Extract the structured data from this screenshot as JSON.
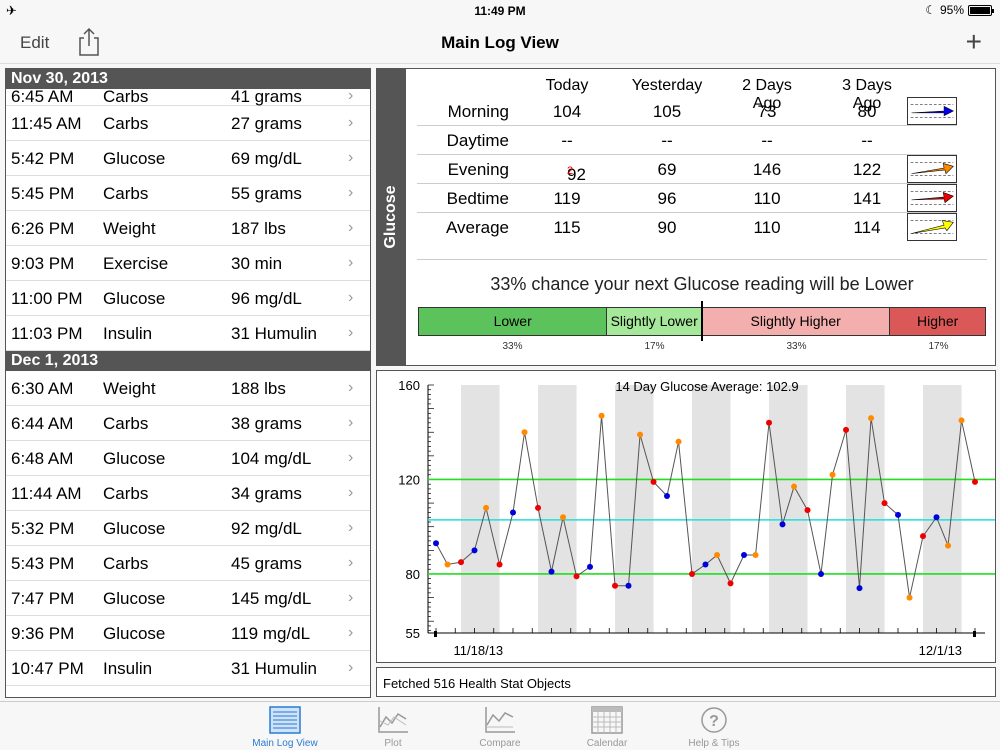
{
  "status_bar": {
    "time": "11:49 PM",
    "battery": "95%"
  },
  "nav": {
    "edit_label": "Edit",
    "title": "Main Log View",
    "add_label": "+"
  },
  "log": {
    "sections": [
      {
        "date": "Nov 30, 2013",
        "rows": [
          {
            "time": "6:45 AM",
            "type": "Carbs",
            "value": "41 grams"
          },
          {
            "time": "11:45 AM",
            "type": "Carbs",
            "value": "27 grams"
          },
          {
            "time": "5:42 PM",
            "type": "Glucose",
            "value": "69 mg/dL"
          },
          {
            "time": "5:45 PM",
            "type": "Carbs",
            "value": "55 grams"
          },
          {
            "time": "6:26 PM",
            "type": "Weight",
            "value": "187 lbs"
          },
          {
            "time": "9:03 PM",
            "type": "Exercise",
            "value": "30 min"
          },
          {
            "time": "11:00 PM",
            "type": "Glucose",
            "value": "96 mg/dL"
          },
          {
            "time": "11:03 PM",
            "type": "Insulin",
            "value": "31 Humulin"
          }
        ]
      },
      {
        "date": "Dec 1, 2013",
        "rows": [
          {
            "time": "6:30 AM",
            "type": "Weight",
            "value": "188 lbs"
          },
          {
            "time": "6:44 AM",
            "type": "Carbs",
            "value": "38 grams"
          },
          {
            "time": "6:48 AM",
            "type": "Glucose",
            "value": "104 mg/dL"
          },
          {
            "time": "11:44 AM",
            "type": "Carbs",
            "value": "34 grams"
          },
          {
            "time": "5:32 PM",
            "type": "Glucose",
            "value": "92 mg/dL"
          },
          {
            "time": "5:43 PM",
            "type": "Carbs",
            "value": "45 grams"
          },
          {
            "time": "7:47 PM",
            "type": "Glucose",
            "value": "145 mg/dL"
          },
          {
            "time": "9:36 PM",
            "type": "Glucose",
            "value": "119 mg/dL"
          },
          {
            "time": "10:47 PM",
            "type": "Insulin",
            "value": "31 Humulin"
          }
        ]
      }
    ]
  },
  "glucose_panel": {
    "tab_label": "Glucose",
    "columns": [
      "Today",
      "Yesterday",
      "2 Days Ago",
      "3 Days Ago"
    ],
    "rows": [
      {
        "label": "Morning",
        "values": [
          "104",
          "105",
          "73",
          "80"
        ],
        "trend_color": "#0000ee"
      },
      {
        "label": "Daytime",
        "values": [
          "--",
          "--",
          "--",
          "--"
        ],
        "trend_color": ""
      },
      {
        "label": "Evening",
        "values": [
          "92",
          "69",
          "146",
          "122"
        ],
        "today_superscript": "2",
        "trend_color": "#ff8a00"
      },
      {
        "label": "Bedtime",
        "values": [
          "119",
          "96",
          "110",
          "141"
        ],
        "trend_color": "#ee0000"
      },
      {
        "label": "Average",
        "values": [
          "115",
          "90",
          "110",
          "114"
        ],
        "trend_color": "#ffff00"
      }
    ],
    "prediction": "33% chance your next Glucose reading will be Lower",
    "probabilities": [
      {
        "label": "Lower",
        "percent": "33%",
        "color": "#5cc35c"
      },
      {
        "label": "Slightly Lower",
        "percent": "17%",
        "color": "#a6e89a"
      },
      {
        "label": "Slightly Higher",
        "percent": "33%",
        "color": "#f3aeae"
      },
      {
        "label": "Higher",
        "percent": "17%",
        "color": "#db5858"
      }
    ]
  },
  "chart_data": {
    "type": "scatter",
    "title": "14 Day Glucose Average: 102.9",
    "ylim": [
      55,
      160
    ],
    "yticks": [
      160,
      120,
      80,
      55
    ],
    "xtick_labels": [
      "11/18/13",
      "12/1/13"
    ],
    "reference_lines": [
      {
        "value": 120,
        "color": "#22dd22"
      },
      {
        "value": 102.9,
        "color": "#22dddd"
      },
      {
        "value": 80,
        "color": "#22dd22"
      }
    ],
    "days": 14,
    "points": [
      {
        "x": 0.0,
        "y": 93,
        "color": "#0000dd"
      },
      {
        "x": 0.3,
        "y": 84,
        "color": "#ff8a00"
      },
      {
        "x": 0.65,
        "y": 85,
        "color": "#ee0000"
      },
      {
        "x": 1.0,
        "y": 90,
        "color": "#0000dd"
      },
      {
        "x": 1.3,
        "y": 108,
        "color": "#ff8a00"
      },
      {
        "x": 1.65,
        "y": 84,
        "color": "#ee0000"
      },
      {
        "x": 2.0,
        "y": 106,
        "color": "#0000dd"
      },
      {
        "x": 2.3,
        "y": 140,
        "color": "#ff8a00"
      },
      {
        "x": 2.65,
        "y": 108,
        "color": "#ee0000"
      },
      {
        "x": 3.0,
        "y": 81,
        "color": "#0000dd"
      },
      {
        "x": 3.3,
        "y": 104,
        "color": "#ff8a00"
      },
      {
        "x": 3.65,
        "y": 79,
        "color": "#ee0000"
      },
      {
        "x": 4.0,
        "y": 83,
        "color": "#0000dd"
      },
      {
        "x": 4.3,
        "y": 147,
        "color": "#ff8a00"
      },
      {
        "x": 4.65,
        "y": 75,
        "color": "#ee0000"
      },
      {
        "x": 5.0,
        "y": 75,
        "color": "#0000dd"
      },
      {
        "x": 5.3,
        "y": 139,
        "color": "#ff8a00"
      },
      {
        "x": 5.65,
        "y": 119,
        "color": "#ee0000"
      },
      {
        "x": 6.0,
        "y": 113,
        "color": "#0000dd"
      },
      {
        "x": 6.3,
        "y": 136,
        "color": "#ff8a00"
      },
      {
        "x": 6.65,
        "y": 80,
        "color": "#ee0000"
      },
      {
        "x": 7.0,
        "y": 84,
        "color": "#0000dd"
      },
      {
        "x": 7.3,
        "y": 88,
        "color": "#ff8a00"
      },
      {
        "x": 7.65,
        "y": 76,
        "color": "#ee0000"
      },
      {
        "x": 8.0,
        "y": 88,
        "color": "#0000dd"
      },
      {
        "x": 8.3,
        "y": 88,
        "color": "#ff8a00"
      },
      {
        "x": 8.65,
        "y": 144,
        "color": "#ee0000"
      },
      {
        "x": 9.0,
        "y": 101,
        "color": "#0000dd"
      },
      {
        "x": 9.3,
        "y": 117,
        "color": "#ff8a00"
      },
      {
        "x": 9.65,
        "y": 107,
        "color": "#ee0000"
      },
      {
        "x": 10.0,
        "y": 80,
        "color": "#0000dd"
      },
      {
        "x": 10.3,
        "y": 122,
        "color": "#ff8a00"
      },
      {
        "x": 10.65,
        "y": 141,
        "color": "#ee0000"
      },
      {
        "x": 11.0,
        "y": 74,
        "color": "#0000dd"
      },
      {
        "x": 11.3,
        "y": 146,
        "color": "#ff8a00"
      },
      {
        "x": 11.65,
        "y": 110,
        "color": "#ee0000"
      },
      {
        "x": 12.0,
        "y": 105,
        "color": "#0000dd"
      },
      {
        "x": 12.3,
        "y": 70,
        "color": "#ff8a00"
      },
      {
        "x": 12.65,
        "y": 96,
        "color": "#ee0000"
      },
      {
        "x": 13.0,
        "y": 104,
        "color": "#0000dd"
      },
      {
        "x": 13.3,
        "y": 92,
        "color": "#ff8a00"
      },
      {
        "x": 13.65,
        "y": 145,
        "color": "#ff8a00"
      },
      {
        "x": 14.0,
        "y": 119,
        "color": "#ee0000"
      }
    ],
    "grid": "alternating day shading"
  },
  "footer": {
    "status": "Fetched 516 Health Stat Objects"
  },
  "tabbar": {
    "tabs": [
      {
        "label": "Main Log View",
        "icon": "list-icon",
        "active": true
      },
      {
        "label": "Plot",
        "icon": "plot-icon",
        "active": false
      },
      {
        "label": "Compare",
        "icon": "compare-icon",
        "active": false
      },
      {
        "label": "Calendar",
        "icon": "calendar-icon",
        "active": false
      },
      {
        "label": "Help & Tips",
        "icon": "help-icon",
        "active": false
      }
    ]
  }
}
